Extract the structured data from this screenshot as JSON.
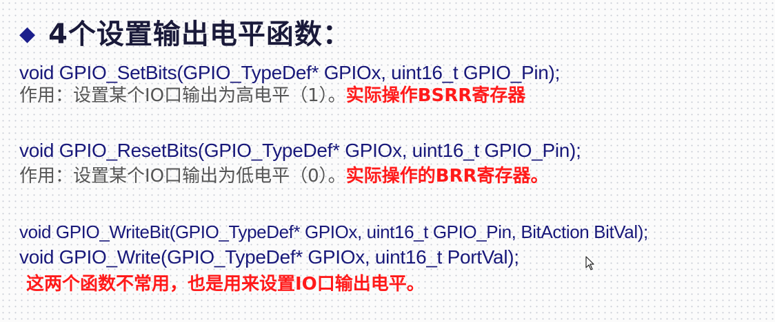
{
  "title": {
    "bullet": "◆",
    "text": "4个设置输出电平函数："
  },
  "functions": [
    {
      "signature": "void GPIO_SetBits(GPIO_TypeDef* GPIOx, uint16_t GPIO_Pin);",
      "desc": "作用：设置某个IO口输出为高电平（1）。",
      "note": "实际操作BSRR寄存器"
    },
    {
      "signature": "void GPIO_ResetBits(GPIO_TypeDef* GPIOx, uint16_t GPIO_Pin);",
      "desc": "作用：设置某个IO口输出为低电平（0）。",
      "note": "实际操作的BRR寄存器。"
    }
  ],
  "extra_signatures": [
    "void GPIO_WriteBit(GPIO_TypeDef* GPIOx, uint16_t GPIO_Pin, BitAction BitVal);",
    "void GPIO_Write(GPIO_TypeDef* GPIOx, uint16_t PortVal);"
  ],
  "footer_note": "这两个函数不常用，也是用来设置IO口输出电平。",
  "colors": {
    "heading": "#1a1a3a",
    "code": "#18187a",
    "description": "#555555",
    "highlight": "#ff1a1a"
  },
  "icons": {
    "bullet": "diamond-bullet-icon",
    "cursor": "mouse-pointer-icon"
  }
}
